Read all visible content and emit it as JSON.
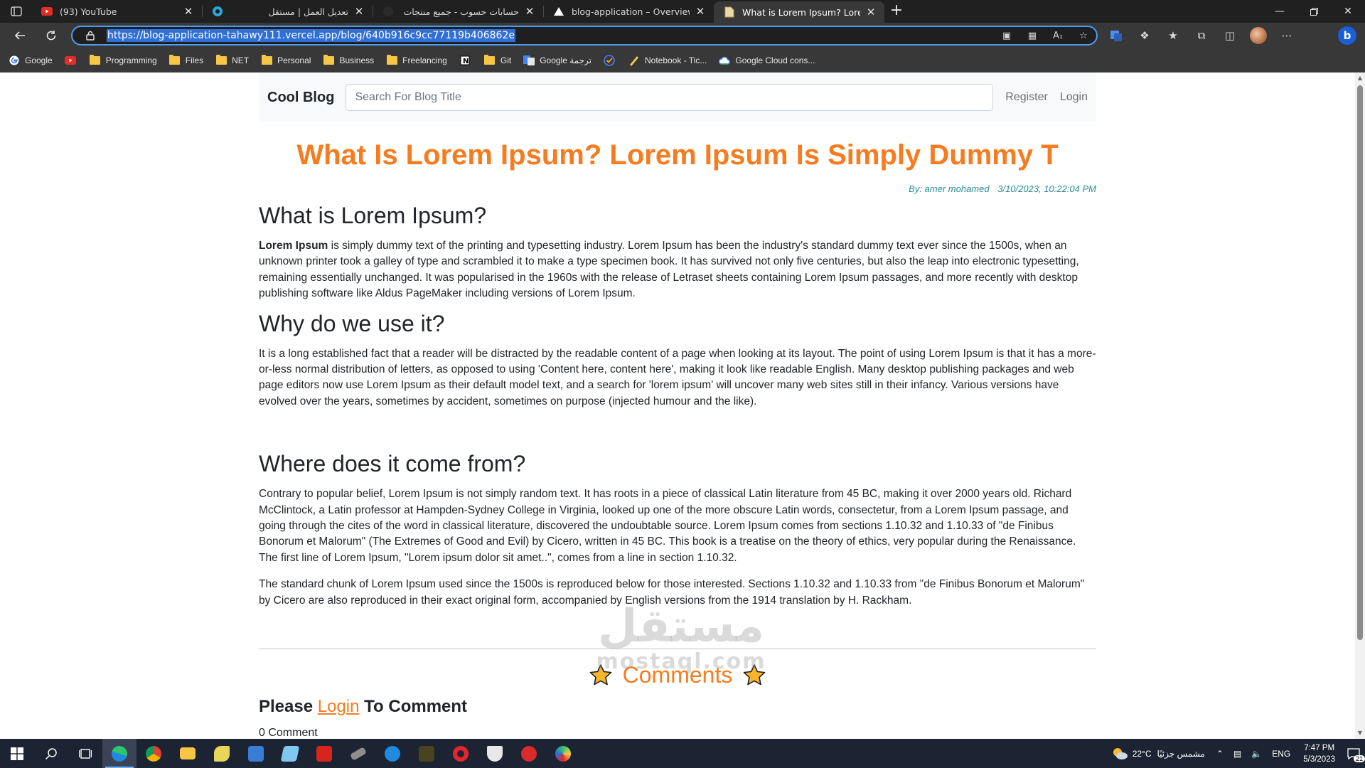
{
  "browser": {
    "tabs": [
      {
        "title": "(93) YouTube",
        "favicon": "youtube-icon",
        "rtl": false,
        "active": false
      },
      {
        "title": "تعديل العمل | مستقل",
        "favicon": "mostaql-icon",
        "rtl": true,
        "active": false
      },
      {
        "title": "حسابات حسوب - جميع منتجات حسـ",
        "favicon": "hsoub-icon",
        "rtl": true,
        "active": false
      },
      {
        "title": "blog-application – Overview - Ve",
        "favicon": "vercel-icon",
        "rtl": false,
        "active": false
      },
      {
        "title": "What is Lorem Ipsum? Lorem Ips",
        "favicon": "page-icon",
        "rtl": false,
        "active": true
      }
    ],
    "url": "https://blog-application-tahawy111.vercel.app/blog/640b916c9cc77119b406862e",
    "bookmarks": [
      "Google",
      "",
      "Programming",
      "Files",
      "NET",
      "Personal",
      "Business",
      "Freelancing",
      "",
      "Git",
      "Google ترجمة",
      "",
      "Notebook - Tic...",
      "Google Cloud cons..."
    ]
  },
  "site": {
    "brand": "Cool Blog",
    "search_placeholder": "Search For Blog Title",
    "register": "Register",
    "login": "Login"
  },
  "post": {
    "title": "What Is Lorem Ipsum? Lorem Ipsum Is Simply Dummy T",
    "author": "By: amer mohamed",
    "date": "3/10/2023, 10:22:04 PM",
    "sections": [
      {
        "heading": "What is Lorem Ipsum?",
        "paragraphs": [
          {
            "bold": "Lorem Ipsum",
            "text": " is simply dummy text of the printing and typesetting industry. Lorem Ipsum has been the industry's standard dummy text ever since the 1500s, when an unknown printer took a galley of type and scrambled it to make a type specimen book. It has survived not only five centuries, but also the leap into electronic typesetting, remaining essentially unchanged. It was popularised in the 1960s with the release of Letraset sheets containing Lorem Ipsum passages, and more recently with desktop publishing software like Aldus PageMaker including versions of Lorem Ipsum."
          }
        ]
      },
      {
        "heading": "Why do we use it?",
        "paragraphs": [
          {
            "bold": "",
            "text": "It is a long established fact that a reader will be distracted by the readable content of a page when looking at its layout. The point of using Lorem Ipsum is that it has a more-or-less normal distribution of letters, as opposed to using 'Content here, content here', making it look like readable English. Many desktop publishing packages and web page editors now use Lorem Ipsum as their default model text, and a search for 'lorem ipsum' will uncover many web sites still in their infancy. Various versions have evolved over the years, sometimes by accident, sometimes on purpose (injected humour and the like)."
          }
        ]
      },
      {
        "heading": "Where does it come from?",
        "paragraphs": [
          {
            "bold": "",
            "text": "Contrary to popular belief, Lorem Ipsum is not simply random text. It has roots in a piece of classical Latin literature from 45 BC, making it over 2000 years old. Richard McClintock, a Latin professor at Hampden-Sydney College in Virginia, looked up one of the more obscure Latin words, consectetur, from a Lorem Ipsum passage, and going through the cites of the word in classical literature, discovered the undoubtable source. Lorem Ipsum comes from sections 1.10.32 and 1.10.33 of \"de Finibus Bonorum et Malorum\" (The Extremes of Good and Evil) by Cicero, written in 45 BC. This book is a treatise on the theory of ethics, very popular during the Renaissance. The first line of Lorem Ipsum, \"Lorem ipsum dolor sit amet..\", comes from a line in section 1.10.32."
          },
          {
            "bold": "",
            "text": "The standard chunk of Lorem Ipsum used since the 1500s is reproduced below for those interested. Sections 1.10.32 and 1.10.33 from \"de Finibus Bonorum et Malorum\" by Cicero are also reproduced in their exact original form, accompanied by English versions from the 1914 translation by H. Rackham."
          }
        ]
      }
    ]
  },
  "comments": {
    "heading": "Comments",
    "please": "Please",
    "login_link": "Login",
    "to_comment": "To Comment",
    "count": "0 Comment"
  },
  "watermark": {
    "arabic": "مستقل",
    "latin": "mostaql.com"
  },
  "taskbar": {
    "weather": "22°C",
    "weather_text": "مشمس جزئيًا",
    "lang": "ENG",
    "time": "7:47 PM",
    "date": "5/3/2023",
    "notifications": "21"
  },
  "colors": {
    "accent": "#f57c1f",
    "byline": "#2a8c96",
    "url_highlight": "#2f6fd6"
  }
}
